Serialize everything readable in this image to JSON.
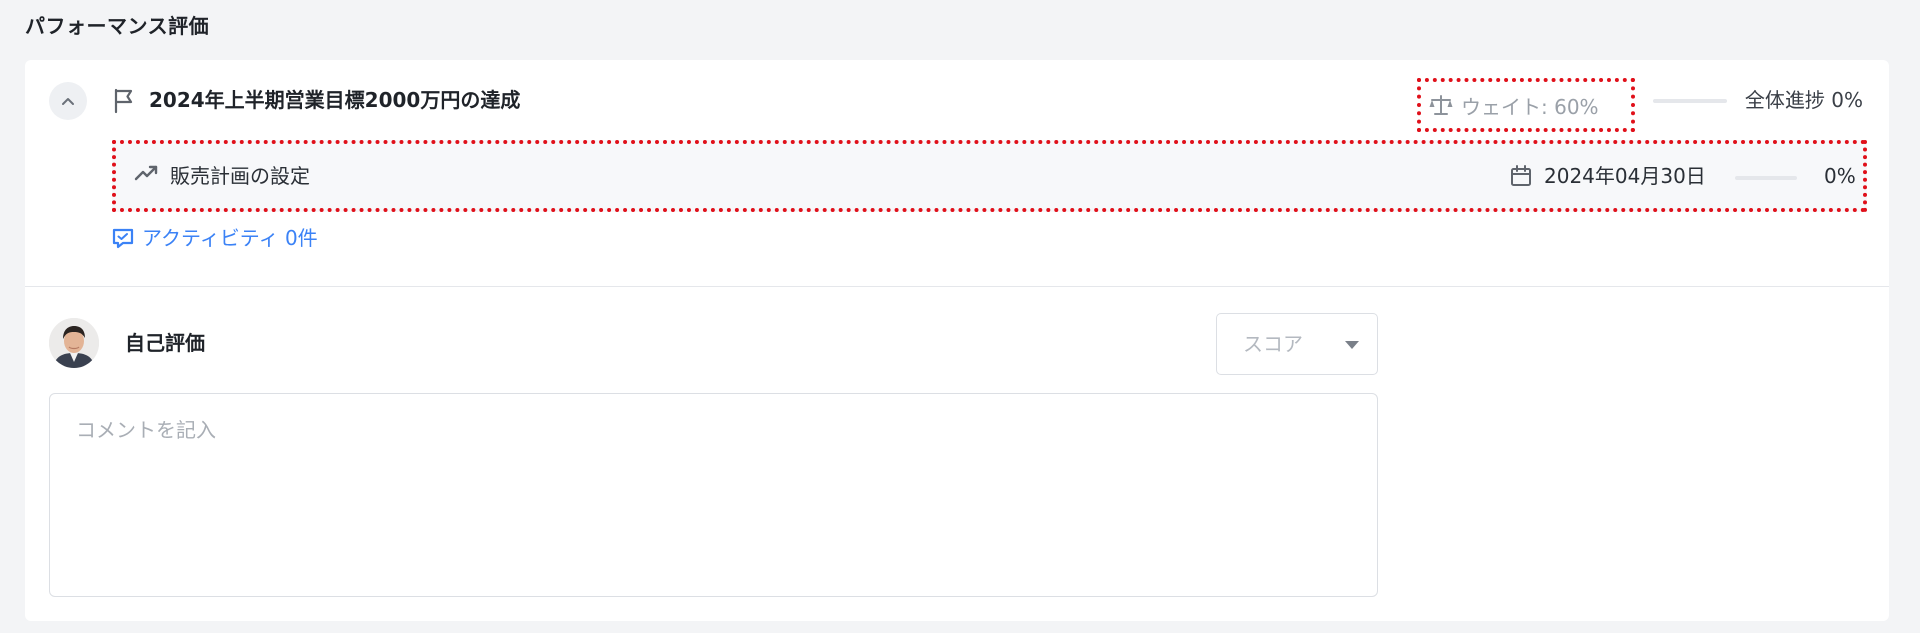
{
  "page": {
    "title": "パフォーマンス評価"
  },
  "objective": {
    "title": "2024年上半期営業目標2000万円の達成",
    "weight_label": "ウェイト: 60%",
    "overall_progress_label": "全体進捗 0%",
    "overall_progress_fraction": 0,
    "collapse_icon": "chevron-up-icon",
    "flag_icon": "flag-icon",
    "weight_icon": "scale-icon"
  },
  "key_result": {
    "title": "販売計画の設定",
    "due_date": "2024年04月30日",
    "progress_label": "0%",
    "progress_fraction": 0,
    "trend_icon": "trending-up-icon",
    "calendar_icon": "calendar-icon"
  },
  "activity": {
    "label": "アクティビティ 0件",
    "icon": "comment-icon"
  },
  "self_evaluation": {
    "label": "自己評価",
    "score_placeholder": "スコア",
    "comment_placeholder": "コメントを記入"
  },
  "colors": {
    "accent": "#3b82f6",
    "highlight_border": "#e0101a"
  }
}
